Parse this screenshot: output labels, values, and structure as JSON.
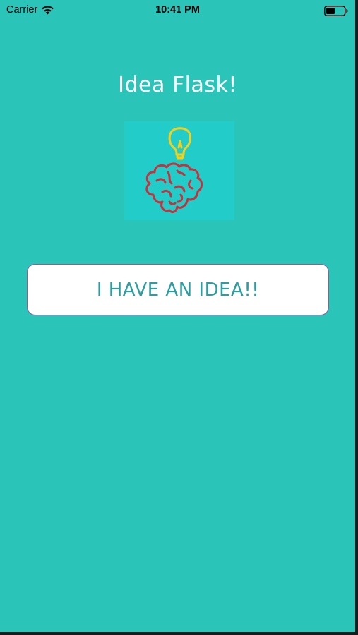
{
  "status_bar": {
    "carrier": "Carrier",
    "time": "10:41 PM",
    "icons": [
      "wifi-icon",
      "battery-icon"
    ]
  },
  "app": {
    "title": "Idea Flask!",
    "logo_icon": "lightbulb-brain-icon"
  },
  "main": {
    "idea_button_label": "I HAVE AN IDEA!!"
  },
  "colors": {
    "background": "#2bc4b9",
    "logo_tile": "#22cdc9",
    "button_text": "#2a9ea0",
    "button_border": "#8e5aa8",
    "bulb": "#f2d11f",
    "brain": "#c8303c"
  }
}
